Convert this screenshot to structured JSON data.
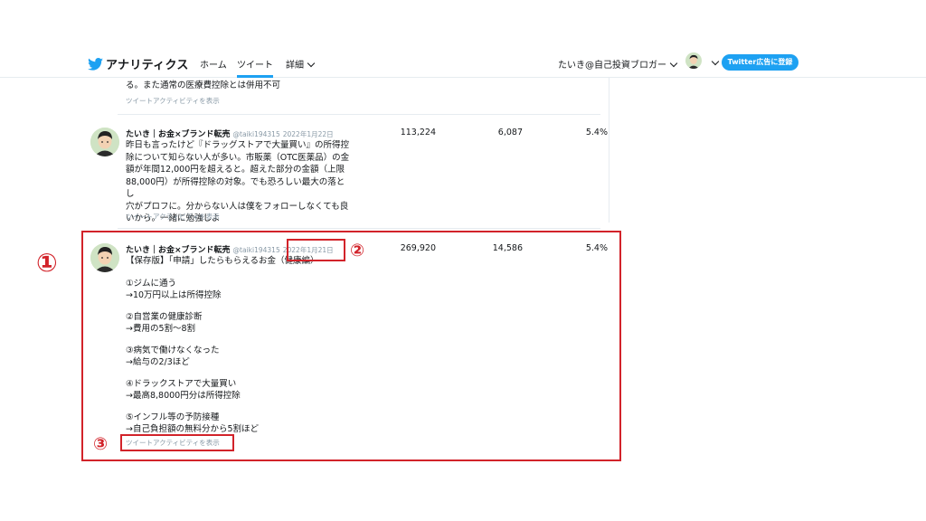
{
  "nav": {
    "logo_text": "アナリティクス",
    "items": [
      "ホーム",
      "ツイート",
      "詳細"
    ],
    "account": "たいき@自己投資ブロガー",
    "promo_button": "Twitter広告に登録"
  },
  "top_partial": {
    "text": "る。また通常の医療費控除とは併用不可",
    "activity_link": "ツイートアクティビティを表示"
  },
  "tweets": [
    {
      "name": "たいき｜お金×ブランド転売",
      "handle": "@taiki194315",
      "date": "2022年1月22日",
      "body": [
        "昨日も言ったけど『ドラッグストアで大量買い』の所得控",
        "除について知らない人が多い。市販薬（OTC医薬品）の金",
        "額が年間12,000円を超えると。超えた部分の金額（上限",
        "88,000円）が所得控除の対象。でも恐ろしい最大の落とし",
        "穴がプロフに。分からない人は僕をフォローしなくても良",
        "いから。一緒に勉強しよ"
      ],
      "impressions": "113,224",
      "engagements": "6,087",
      "rate": "5.4%",
      "activity_link": "ツイートアクティビティを表示"
    },
    {
      "name": "たいき｜お金×ブランド転売",
      "handle": "@taiki194315",
      "date": "2022年1月21日",
      "title": "【保存版】「申請」したらもらえるお金（健康編）",
      "items": [
        {
          "line1": "①ジムに通う",
          "line2": "→10万円以上は所得控除"
        },
        {
          "line1": "②自営業の健康診断",
          "line2": "→費用の5割〜8割"
        },
        {
          "line1": "③病気で働けなくなった",
          "line2": "→給与の2/3ほど"
        },
        {
          "line1": "④ドラックストアで大量買い",
          "line2": "→最高8,8000円分は所得控除"
        },
        {
          "line1": "⑤インフル等の予防接種",
          "line2": "→自己負担額の無料分から5割ほど"
        }
      ],
      "impressions": "269,920",
      "engagements": "14,586",
      "rate": "5.4%",
      "activity_link": "ツイートアクティビティを表示"
    }
  ],
  "annotations": [
    "①",
    "②",
    "③"
  ],
  "colors": {
    "accent": "#1da1f2",
    "annotation": "#d2232a",
    "muted": "#8899a6"
  }
}
